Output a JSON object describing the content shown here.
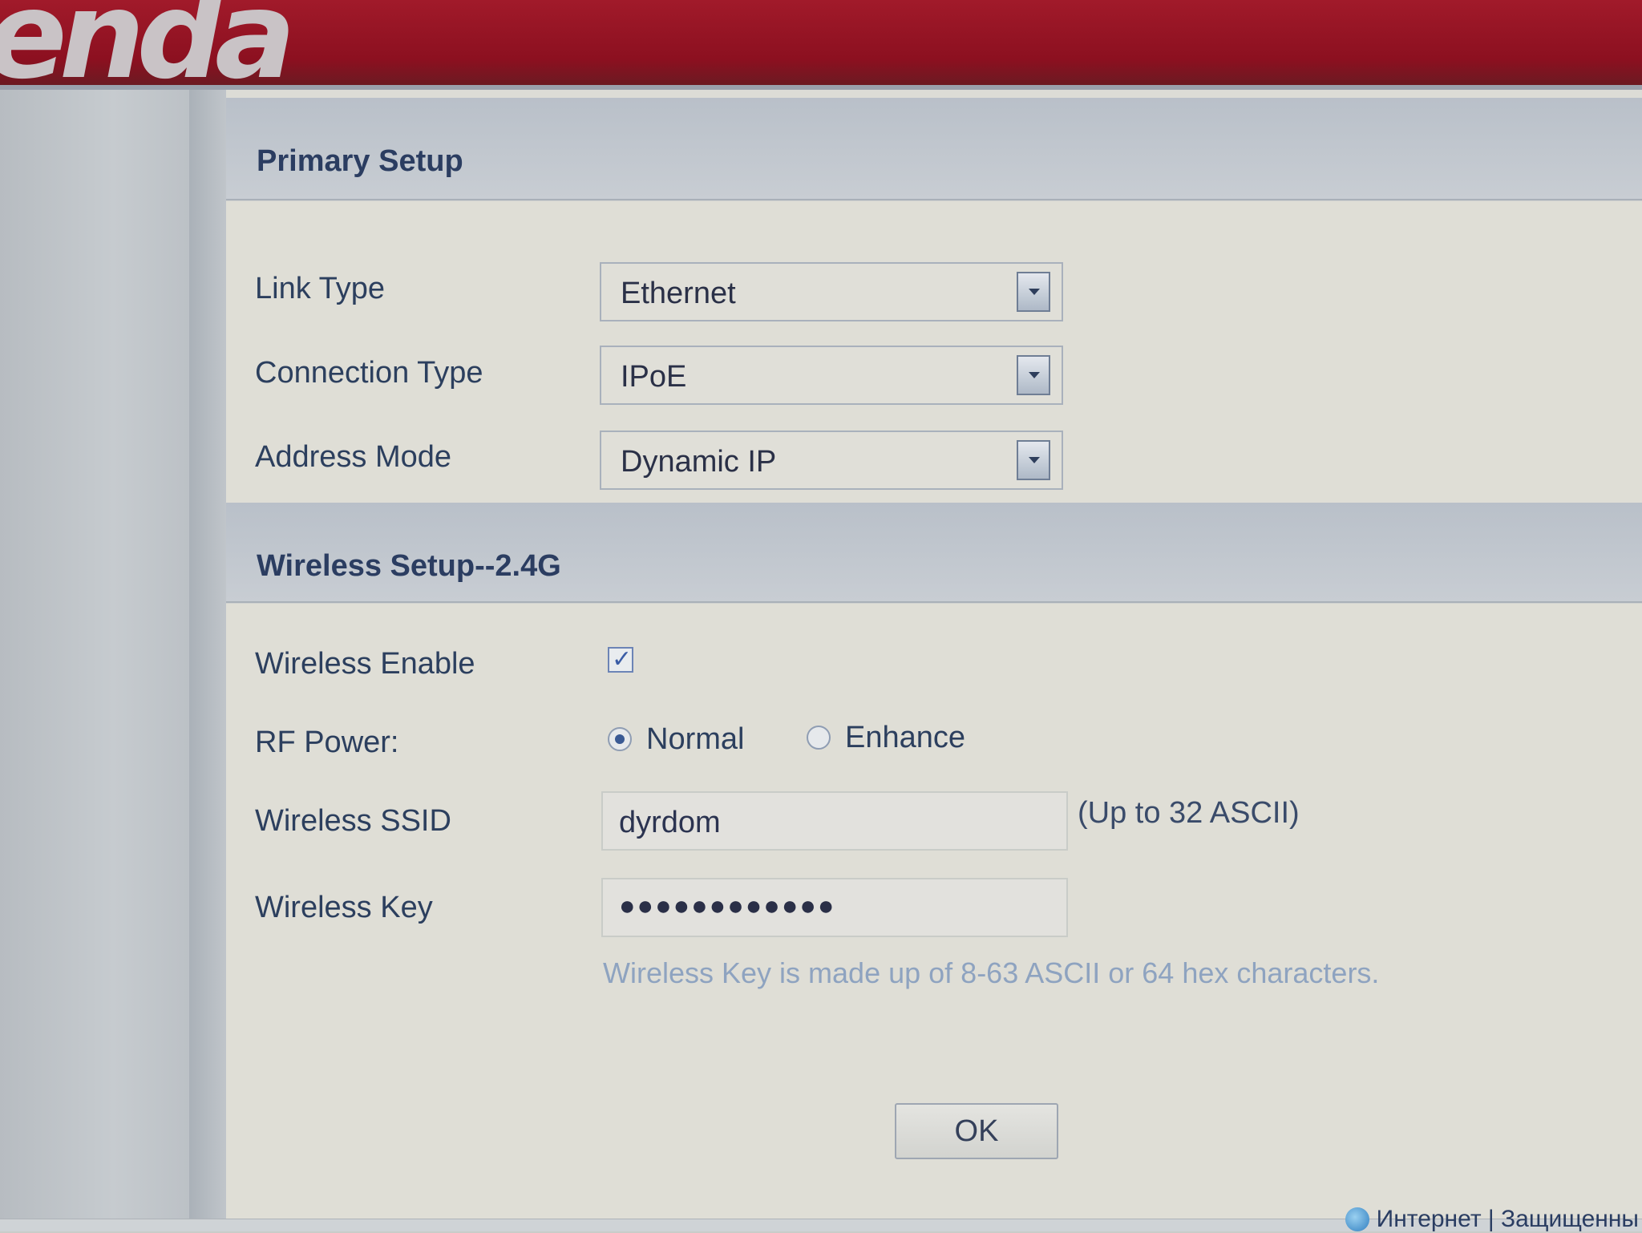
{
  "brand": {
    "logo_text": "enda"
  },
  "primary_setup": {
    "title": "Primary Setup",
    "link_type": {
      "label": "Link Type",
      "value": "Ethernet"
    },
    "connection_type": {
      "label": "Connection Type",
      "value": "IPoE"
    },
    "address_mode": {
      "label": "Address Mode",
      "value": "Dynamic IP"
    }
  },
  "wireless_setup": {
    "title": "Wireless Setup--2.4G",
    "enable": {
      "label": "Wireless Enable",
      "checked": true
    },
    "rf_power": {
      "label": "RF Power:",
      "options": [
        "Normal",
        "Enhance"
      ],
      "selected": "Normal"
    },
    "ssid": {
      "label": "Wireless SSID",
      "value": "dyrdom",
      "hint": "(Up to 32 ASCII)"
    },
    "key": {
      "label": "Wireless Key",
      "masked_value": "●●●●●●●●●●●●",
      "help": "Wireless Key is made up of 8-63 ASCII or 64 hex characters."
    }
  },
  "actions": {
    "ok_label": "OK"
  },
  "statusbar": {
    "text": "Интернет | Защищенны"
  },
  "colors": {
    "header_red": "#8c1020",
    "label_blue": "#2c3f5e",
    "help_blue": "#8ea3c0"
  }
}
